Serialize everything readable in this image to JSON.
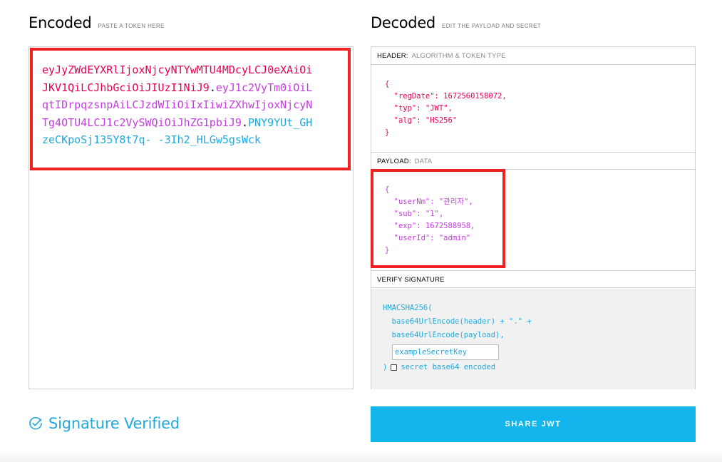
{
  "encoded": {
    "title": "Encoded",
    "subtitle": "PASTE A TOKEN HERE",
    "token_header": "eyJyZWdEYXRlIjoxNjcyNTYwMTU4MDcyLCJ0eXAiOiJKV1QiLCJhbGciOiJIUzI1NiJ9",
    "token_payload": "eyJ1c2VyTm0iOiLqtIDrpqzsnpAiLCJzdWIiOiIxIiwiZXhwIjoxNjcyNTg4OTU4LCJ1c2VySWQiOiJhZG1pbiJ9",
    "token_signature": "PNY9YUt_GHzeCKpoSj135Y8t7q-\n-3Ih2_HLGw5gsWck",
    "dot": "."
  },
  "decoded": {
    "title": "Decoded",
    "subtitle": "EDIT THE PAYLOAD AND SECRET",
    "header_section": {
      "label": "HEADER:",
      "muted": "ALGORITHM & TOKEN TYPE"
    },
    "header_json": "{\n  \"regDate\": 1672560158072,\n  \"typ\": \"JWT\",\n  \"alg\": \"HS256\"\n}",
    "payload_section": {
      "label": "PAYLOAD:",
      "muted": "DATA"
    },
    "payload_json": "{\n  \"userNm\": \"관리자\",\n  \"sub\": \"1\",\n  \"exp\": 1672588958,\n  \"userId\": \"admin\"\n}",
    "verify_section": {
      "label": "VERIFY SIGNATURE"
    },
    "verify_code": "HMACSHA256(\n  base64UrlEncode(header) + \".\" +\n  base64UrlEncode(payload),",
    "secret_value": "exampleSecretKey",
    "verify_close": ")",
    "base64_label": "secret base64 encoded"
  },
  "status": {
    "text": "Signature Verified",
    "icon": "check-circle-icon",
    "color": "#1fa9dc"
  },
  "share_button": {
    "label": "SHARE JWT",
    "color": "#13b6ec"
  },
  "colors": {
    "header": "#e8024f",
    "payload": "#c53ce0",
    "signature": "#1fa9dc",
    "highlight": "#ee2222"
  }
}
